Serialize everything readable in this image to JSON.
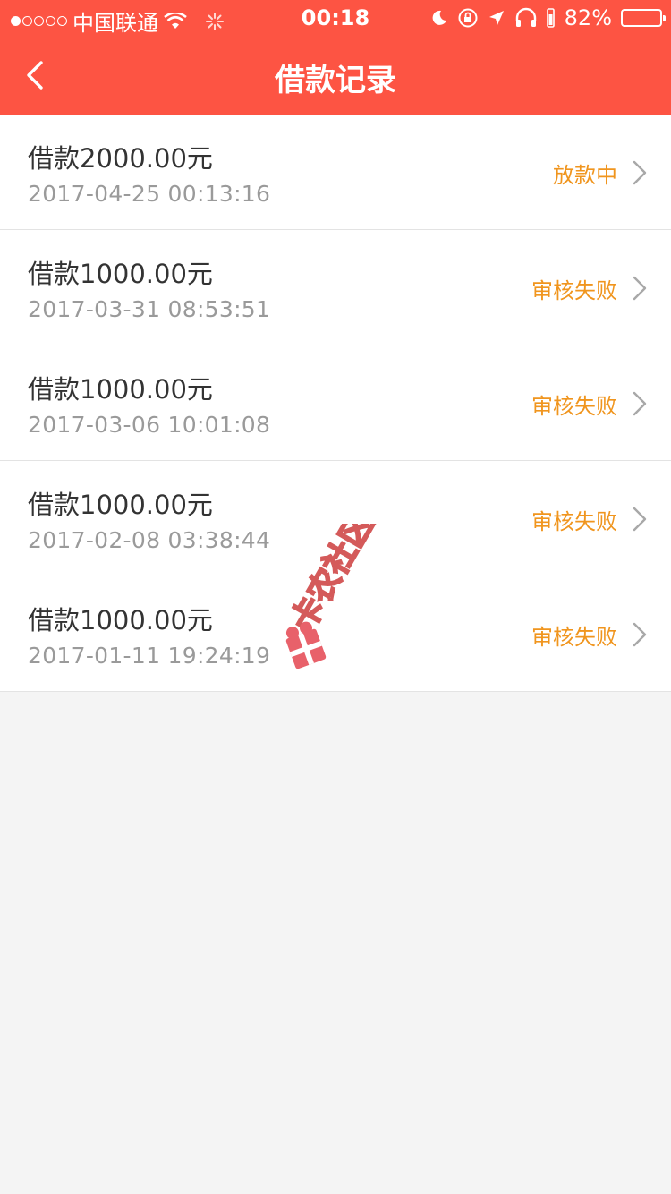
{
  "status_bar": {
    "carrier": "中国联通",
    "time": "00:18",
    "battery": "82%",
    "battery_level": 0.82
  },
  "header": {
    "title": "借款记录"
  },
  "records": [
    {
      "amount": "借款2000.00元",
      "date": "2017-04-25 00:13:16",
      "status": "放款中"
    },
    {
      "amount": "借款1000.00元",
      "date": "2017-03-31 08:53:51",
      "status": "审核失败"
    },
    {
      "amount": "借款1000.00元",
      "date": "2017-03-06 10:01:08",
      "status": "审核失败"
    },
    {
      "amount": "借款1000.00元",
      "date": "2017-02-08 03:38:44",
      "status": "审核失败"
    },
    {
      "amount": "借款1000.00元",
      "date": "2017-01-11 19:24:19",
      "status": "审核失败"
    }
  ],
  "watermark": {
    "text": "卡农社区"
  },
  "colors": {
    "header_bg": "#fd5443",
    "status_text": "#f0951e"
  }
}
